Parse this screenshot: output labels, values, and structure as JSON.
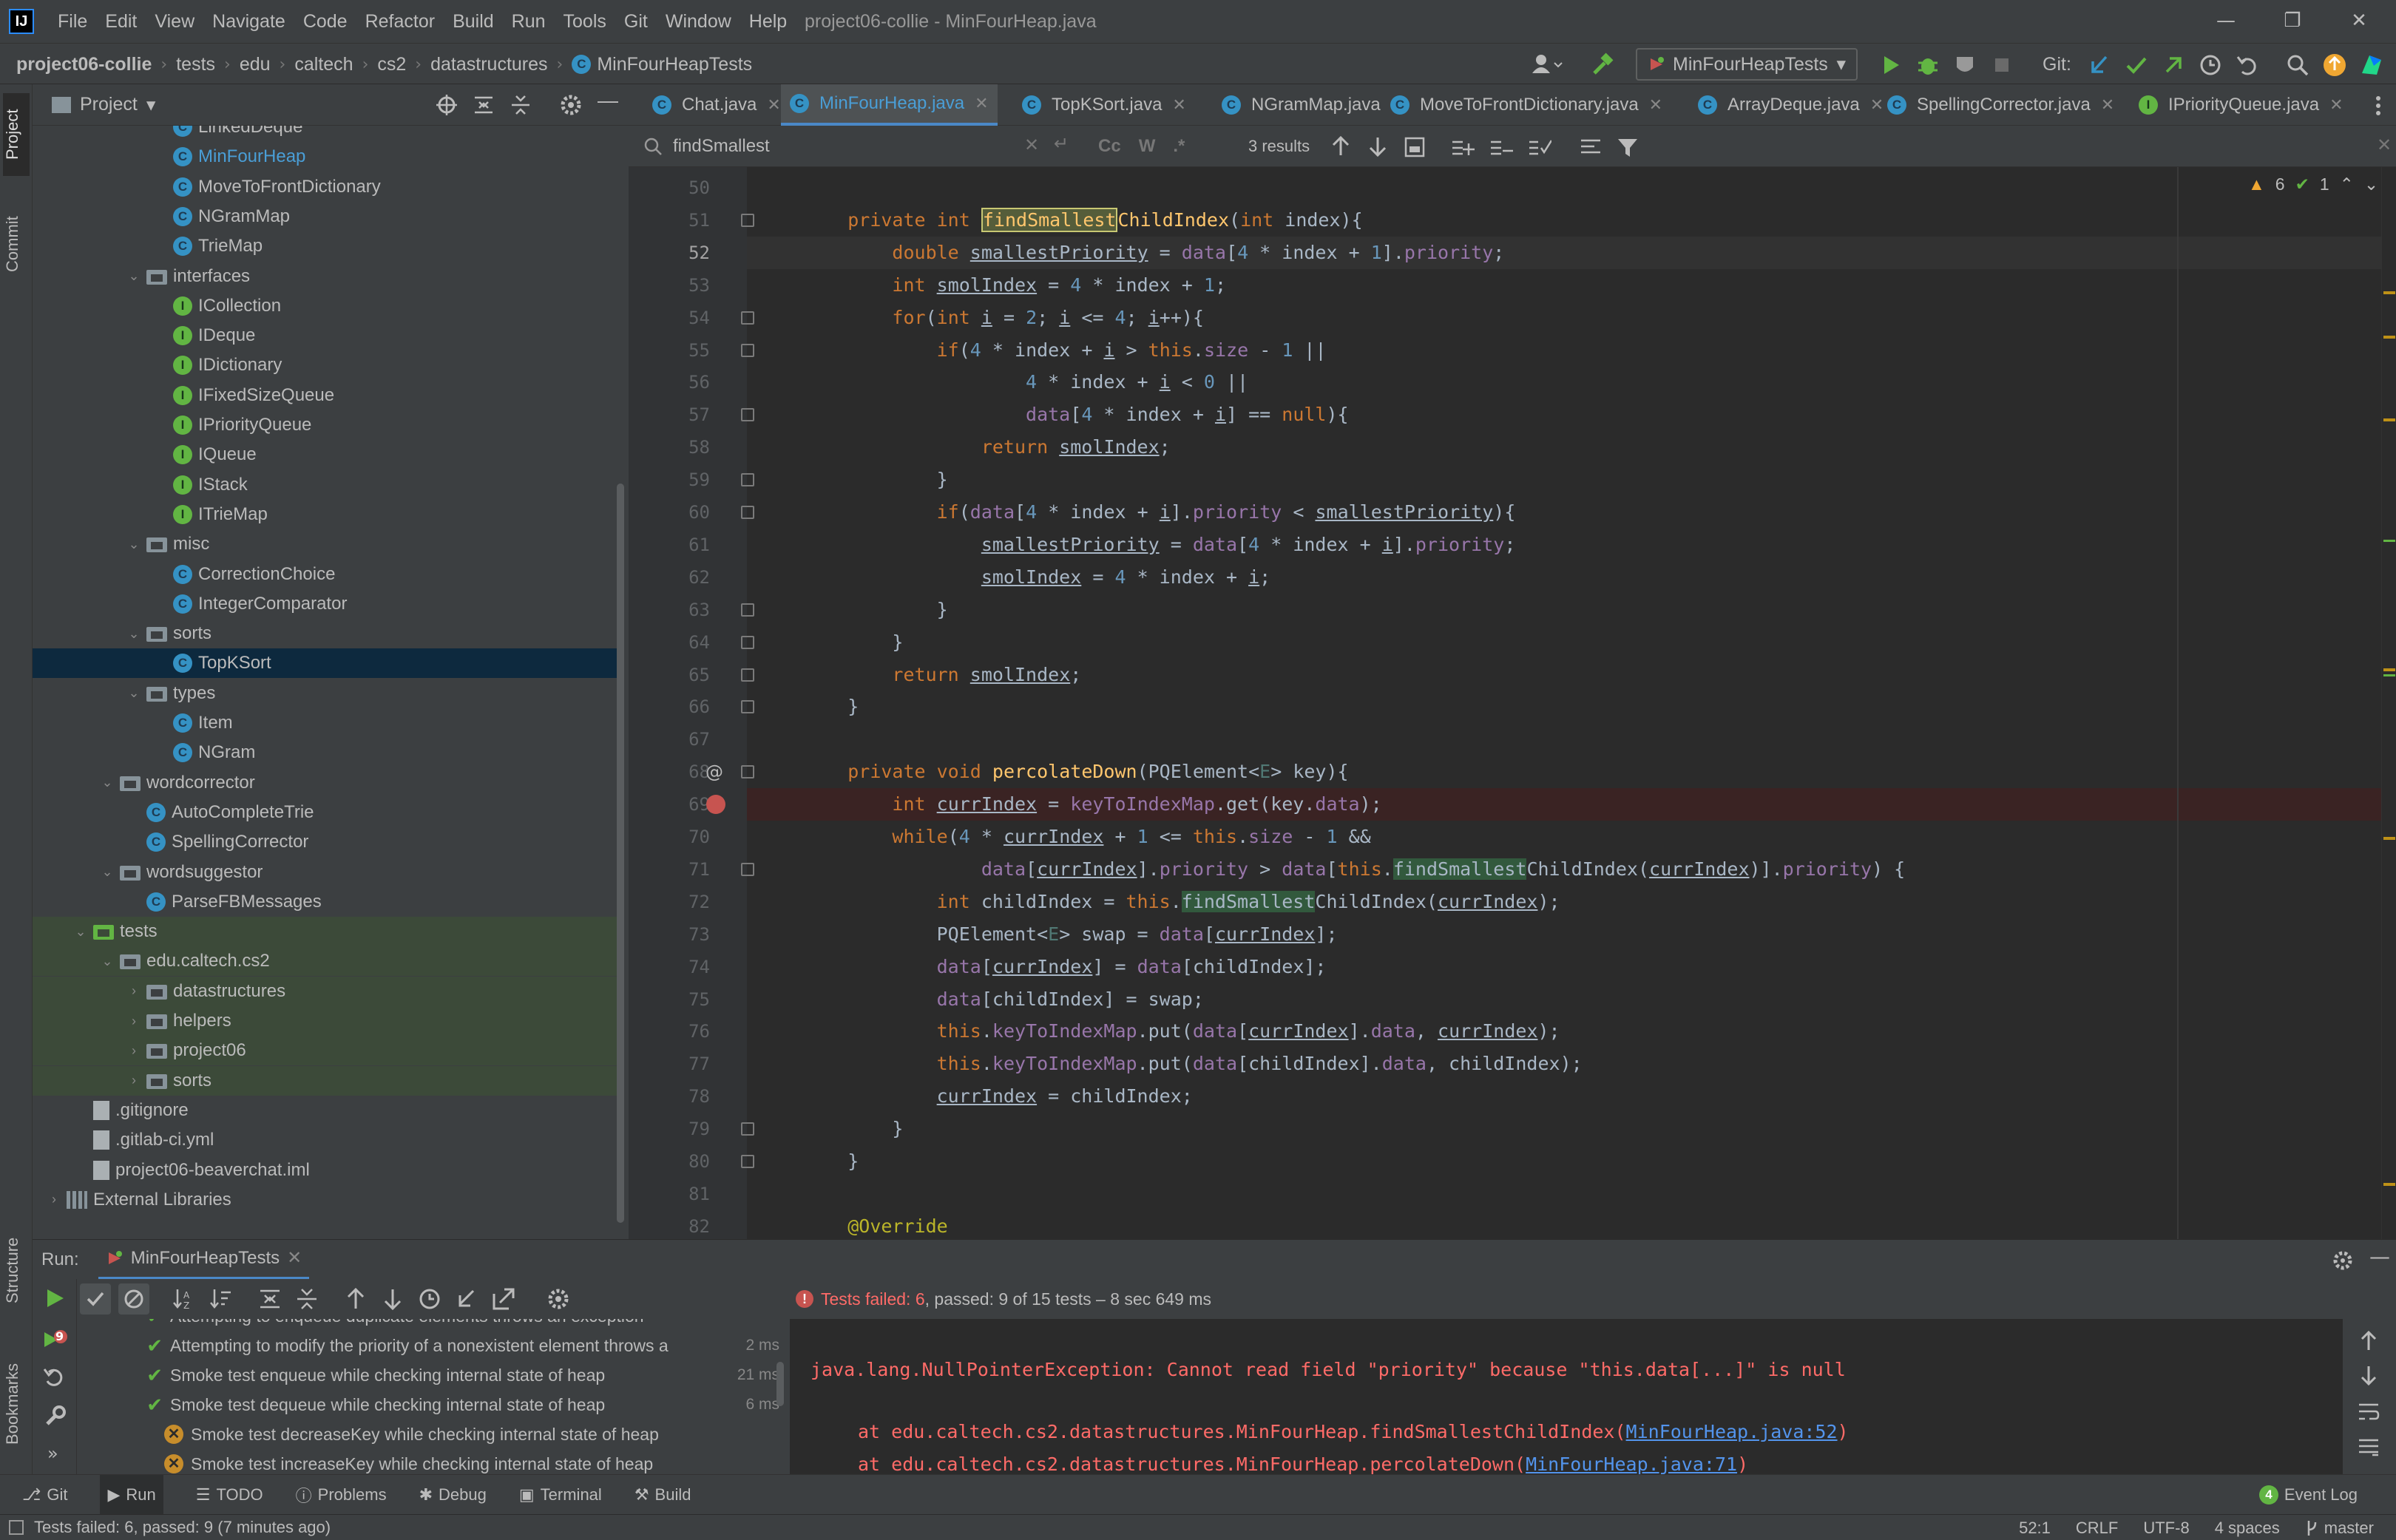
{
  "titlebar": {
    "menus": [
      "File",
      "Edit",
      "View",
      "Navigate",
      "Code",
      "Refactor",
      "Build",
      "Run",
      "Tools",
      "Git",
      "Window",
      "Help"
    ],
    "window_title": "project06-collie - MinFourHeap.java"
  },
  "navbar": {
    "breadcrumbs": [
      "project06-collie",
      "tests",
      "edu",
      "caltech",
      "cs2",
      "datastructures",
      "MinFourHeapTests"
    ],
    "run_config": "MinFourHeapTests",
    "git_label": "Git:"
  },
  "project": {
    "header": "Project",
    "tree": [
      {
        "label": "LinkedDeque",
        "kind": "class",
        "indent": 2
      },
      {
        "label": "MinFourHeap",
        "kind": "class",
        "indent": 2,
        "active": true
      },
      {
        "label": "MoveToFrontDictionary",
        "kind": "class",
        "indent": 2
      },
      {
        "label": "NGramMap",
        "kind": "class",
        "indent": 2
      },
      {
        "label": "TrieMap",
        "kind": "class",
        "indent": 2
      },
      {
        "label": "interfaces",
        "kind": "folder",
        "indent": 1,
        "open": true
      },
      {
        "label": "ICollection",
        "kind": "interface",
        "indent": 2
      },
      {
        "label": "IDeque",
        "kind": "interface",
        "indent": 2
      },
      {
        "label": "IDictionary",
        "kind": "interface",
        "indent": 2
      },
      {
        "label": "IFixedSizeQueue",
        "kind": "interface",
        "indent": 2
      },
      {
        "label": "IPriorityQueue",
        "kind": "interface",
        "indent": 2
      },
      {
        "label": "IQueue",
        "kind": "interface",
        "indent": 2
      },
      {
        "label": "IStack",
        "kind": "interface",
        "indent": 2
      },
      {
        "label": "ITrieMap",
        "kind": "interface",
        "indent": 2
      },
      {
        "label": "misc",
        "kind": "folder",
        "indent": 1,
        "open": true
      },
      {
        "label": "CorrectionChoice",
        "kind": "class",
        "indent": 2
      },
      {
        "label": "IntegerComparator",
        "kind": "class",
        "indent": 2
      },
      {
        "label": "sorts",
        "kind": "folder",
        "indent": 1,
        "open": true
      },
      {
        "label": "TopKSort",
        "kind": "class",
        "indent": 2,
        "selected": true
      },
      {
        "label": "types",
        "kind": "folder",
        "indent": 1,
        "open": true
      },
      {
        "label": "Item",
        "kind": "class",
        "indent": 2
      },
      {
        "label": "NGram",
        "kind": "class",
        "indent": 2
      },
      {
        "label": "wordcorrector",
        "kind": "folder",
        "indent": 0,
        "open": true
      },
      {
        "label": "AutoCompleteTrie",
        "kind": "class",
        "indent": 1
      },
      {
        "label": "SpellingCorrector",
        "kind": "class",
        "indent": 1
      },
      {
        "label": "wordsuggestor",
        "kind": "folder",
        "indent": 0,
        "open": true
      },
      {
        "label": "ParseFBMessages",
        "kind": "class",
        "indent": 1
      },
      {
        "label": "tests",
        "kind": "srcfolder",
        "indent": -1,
        "open": true,
        "green": true
      },
      {
        "label": "edu.caltech.cs2",
        "kind": "folder",
        "indent": 0,
        "open": true,
        "green": true
      },
      {
        "label": "datastructures",
        "kind": "folder",
        "indent": 1,
        "open": false,
        "green": true
      },
      {
        "label": "helpers",
        "kind": "folder",
        "indent": 1,
        "open": false,
        "green": true
      },
      {
        "label": "project06",
        "kind": "folder",
        "indent": 1,
        "open": false,
        "green": true
      },
      {
        "label": "sorts",
        "kind": "folder",
        "indent": 1,
        "open": false,
        "green": true
      },
      {
        "label": ".gitignore",
        "kind": "file",
        "indent": -1
      },
      {
        "label": ".gitlab-ci.yml",
        "kind": "file",
        "indent": -1
      },
      {
        "label": "project06-beaverchat.iml",
        "kind": "file",
        "indent": -1
      },
      {
        "label": "External Libraries",
        "kind": "lib",
        "indent": -2,
        "open": false
      }
    ]
  },
  "editor": {
    "tabs": [
      {
        "label": "Chat.java",
        "icon": "c"
      },
      {
        "label": "MinFourHeap.java",
        "icon": "c",
        "active": true
      },
      {
        "label": "TopKSort.java",
        "icon": "c"
      },
      {
        "label": "NGramMap.java",
        "icon": "c"
      },
      {
        "label": "MoveToFrontDictionary.java",
        "icon": "c"
      },
      {
        "label": "ArrayDeque.java",
        "icon": "c"
      },
      {
        "label": "SpellingCorrector.java",
        "icon": "c"
      },
      {
        "label": "IPriorityQueue.java",
        "icon": "i"
      }
    ],
    "find": {
      "query": "findSmallest",
      "options": [
        "Cc",
        "W",
        ".*"
      ],
      "results": "3 results"
    },
    "warnings": "6",
    "checks": "1",
    "first_line": 50,
    "current_line": 52,
    "breakpoint_line": 69,
    "lines": [
      "",
      "    <span class=\"kw\">private int</span> <span class=\"fn hl1\">findSmallest</span><span class=\"fn\">ChildIndex</span>(<span class=\"kw\">int</span> index){",
      "        <span class=\"kw\">double</span> <span class=\"ul\">smallestPriority</span> = <span class=\"fld\">data</span>[<span class=\"num\">4</span> * index + <span class=\"num\">1</span>].<span class=\"fld\">priority</span>;",
      "        <span class=\"kw\">int</span> <span class=\"ul\">smolIndex</span> = <span class=\"num\">4</span> * index + <span class=\"num\">1</span>;",
      "        <span class=\"kw\">for</span>(<span class=\"kw\">int</span> <span class=\"ul\">i</span> = <span class=\"num\">2</span>; <span class=\"ul\">i</span> &lt;= <span class=\"num\">4</span>; <span class=\"ul\">i</span>++){",
      "            <span class=\"kw\">if</span>(<span class=\"num\">4</span> * index + <span class=\"ul\">i</span> &gt; <span class=\"kw\">this</span>.<span class=\"fld\">size</span> - <span class=\"num\">1</span> ||",
      "                    <span class=\"num\">4</span> * index + <span class=\"ul\">i</span> &lt; <span class=\"num\">0</span> ||",
      "                    <span class=\"fld\">data</span>[<span class=\"num\">4</span> * index + <span class=\"ul\">i</span>] == <span class=\"kw\">null</span>){",
      "                <span class=\"kw\">return</span> <span class=\"ul\">smolIndex</span>;",
      "            }",
      "            <span class=\"kw\">if</span>(<span class=\"fld\">data</span>[<span class=\"num\">4</span> * index + <span class=\"ul\">i</span>].<span class=\"fld\">priority</span> &lt; <span class=\"ul\">smallestPriority</span>){",
      "                <span class=\"ul\">smallestPriority</span> = <span class=\"fld\">data</span>[<span class=\"num\">4</span> * index + <span class=\"ul\">i</span>].<span class=\"fld\">priority</span>;",
      "                <span class=\"ul\">smolIndex</span> = <span class=\"num\">4</span> * index + <span class=\"ul\">i</span>;",
      "            }",
      "        }",
      "        <span class=\"kw\">return</span> <span class=\"ul\">smolIndex</span>;",
      "    }",
      "",
      "    <span class=\"kw\">private void</span> <span class=\"fn\">percolateDown</span>(PQElement&lt;<span class=\"ty\">E</span>&gt; key){",
      "        <span class=\"kw\">int</span> <span class=\"ul\">currIndex</span> = <span class=\"fld\">keyToIndexMap</span>.get(key.<span class=\"fld\">data</span>);",
      "        <span class=\"kw\">while</span>(<span class=\"num\">4</span> * <span class=\"ul\">currIndex</span> + <span class=\"num\">1</span> &lt;= <span class=\"kw\">this</span>.<span class=\"fld\">size</span> - <span class=\"num\">1</span> &amp;&amp;",
      "                <span class=\"fld\">data</span>[<span class=\"ul\">currIndex</span>].<span class=\"fld\">priority</span> &gt; <span class=\"fld\">data</span>[<span class=\"kw\">this</span>.<span class=\"hl\">findSmallest</span>ChildIndex(<span class=\"ul\">currIndex</span>)].<span class=\"fld\">priority</span>) {",
      "            <span class=\"kw\">int</span> childIndex = <span class=\"kw\">this</span>.<span class=\"hl\">findSmallest</span>ChildIndex(<span class=\"ul\">currIndex</span>);",
      "            PQElement&lt;<span class=\"ty\">E</span>&gt; swap = <span class=\"fld\">data</span>[<span class=\"ul\">currIndex</span>];",
      "            <span class=\"fld\">data</span>[<span class=\"ul\">currIndex</span>] = <span class=\"fld\">data</span>[childIndex];",
      "            <span class=\"fld\">data</span>[childIndex] = swap;",
      "            <span class=\"kw\">this</span>.<span class=\"fld\">keyToIndexMap</span>.put(<span class=\"fld\">data</span>[<span class=\"ul\">currIndex</span>].<span class=\"fld\">data</span>, <span class=\"ul\">currIndex</span>);",
      "            <span class=\"kw\">this</span>.<span class=\"fld\">keyToIndexMap</span>.put(<span class=\"fld\">data</span>[childIndex].<span class=\"fld\">data</span>, childIndex);",
      "            <span class=\"ul\">currIndex</span> = childIndex;",
      "        }",
      "    }",
      "",
      "    <span class=\"ann\">@Override</span>"
    ]
  },
  "run": {
    "label": "Run:",
    "tab": "MinFourHeapTests",
    "summary_failed": "Tests failed: 6",
    "summary_rest": ", passed: 9 of 15 tests – 8 sec 649 ms",
    "badge": "9",
    "tests": [
      {
        "label": "Attempting to enqueue duplicate elements throws an exception",
        "status": "ok",
        "time": ""
      },
      {
        "label": "Attempting to modify the priority of a nonexistent element throws a",
        "status": "ok",
        "time": "2 ms"
      },
      {
        "label": "Smoke test enqueue while checking internal state of heap",
        "status": "ok",
        "time": "21 ms"
      },
      {
        "label": "Smoke test dequeue while checking internal state of heap",
        "status": "ok",
        "time": "6 ms"
      },
      {
        "label": "Smoke test decreaseKey while checking internal state of heap",
        "status": "fail",
        "time": ""
      },
      {
        "label": "Smoke test increaseKey while checking internal state of heap",
        "status": "fail",
        "time": ""
      }
    ],
    "console": {
      "exception": "java.lang.NullPointerException: Cannot read field \"priority\" because \"this.data[...]\" is null",
      "trace": [
        {
          "prefix": "at edu.caltech.cs2.datastructures.MinFourHeap.findSmallestChildIndex(",
          "link": "MinFourHeap.java:52",
          "suffix": ")"
        },
        {
          "prefix": "at edu.caltech.cs2.datastructures.MinFourHeap.percolateDown(",
          "link": "MinFourHeap.java:71",
          "suffix": ")"
        }
      ]
    }
  },
  "toolwindows": [
    {
      "label": "Git",
      "icon": "git-icon"
    },
    {
      "label": "Run",
      "icon": "run-icon",
      "active": true
    },
    {
      "label": "TODO",
      "icon": "todo-icon"
    },
    {
      "label": "Problems",
      "icon": "problems-icon"
    },
    {
      "label": "Debug",
      "icon": "debug-icon"
    },
    {
      "label": "Terminal",
      "icon": "terminal-icon"
    },
    {
      "label": "Build",
      "icon": "build-icon"
    }
  ],
  "event_log": {
    "count": "4",
    "label": "Event Log"
  },
  "status": {
    "message": "Tests failed: 6, passed: 9 (7 minutes ago)",
    "position": "52:1",
    "line_sep": "CRLF",
    "encoding": "UTF-8",
    "indent": "4 spaces",
    "branch": "master"
  },
  "left_strip": [
    "Project",
    "Commit",
    "Structure",
    "Bookmarks"
  ],
  "colors": {
    "accent": "#4a88c7",
    "error": "#ff6b68",
    "ok": "#62b543",
    "warn": "#c78d2b"
  }
}
